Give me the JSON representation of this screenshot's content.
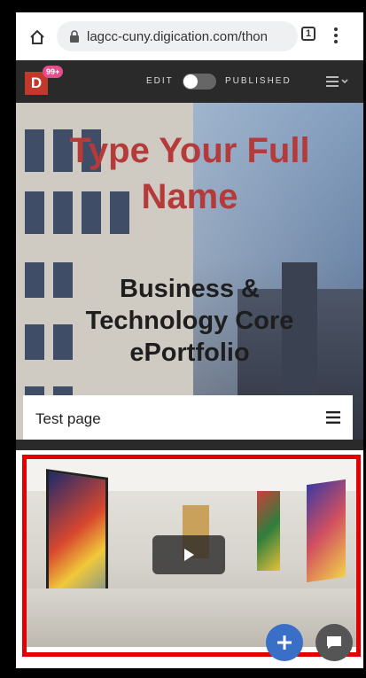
{
  "browser": {
    "url": "lagcc-cuny.digication.com/thon",
    "tab_count": "1"
  },
  "app_bar": {
    "logo_letter": "D",
    "notification_badge": "99+",
    "edit_label": "EDIT",
    "published_label": "PUBLISHED",
    "toggle_on": false
  },
  "hero": {
    "name": "Type Your Full Name",
    "title": "Business & Technology Core ePortfolio"
  },
  "page_nav": {
    "current_page": "Test page"
  },
  "icons": {
    "home": "home-icon",
    "lock": "lock-icon",
    "tabs": "tabs-icon",
    "menu": "more-vert-icon",
    "page_menu": "page-menu-icon",
    "hamburger": "hamburger-icon",
    "play": "play-icon",
    "add": "plus-icon",
    "chat": "chat-icon"
  },
  "colors": {
    "brand_red": "#c0392b",
    "hero_name": "#b53a3a",
    "highlight_frame": "#e30000",
    "fab_add": "#3a6fc7"
  }
}
